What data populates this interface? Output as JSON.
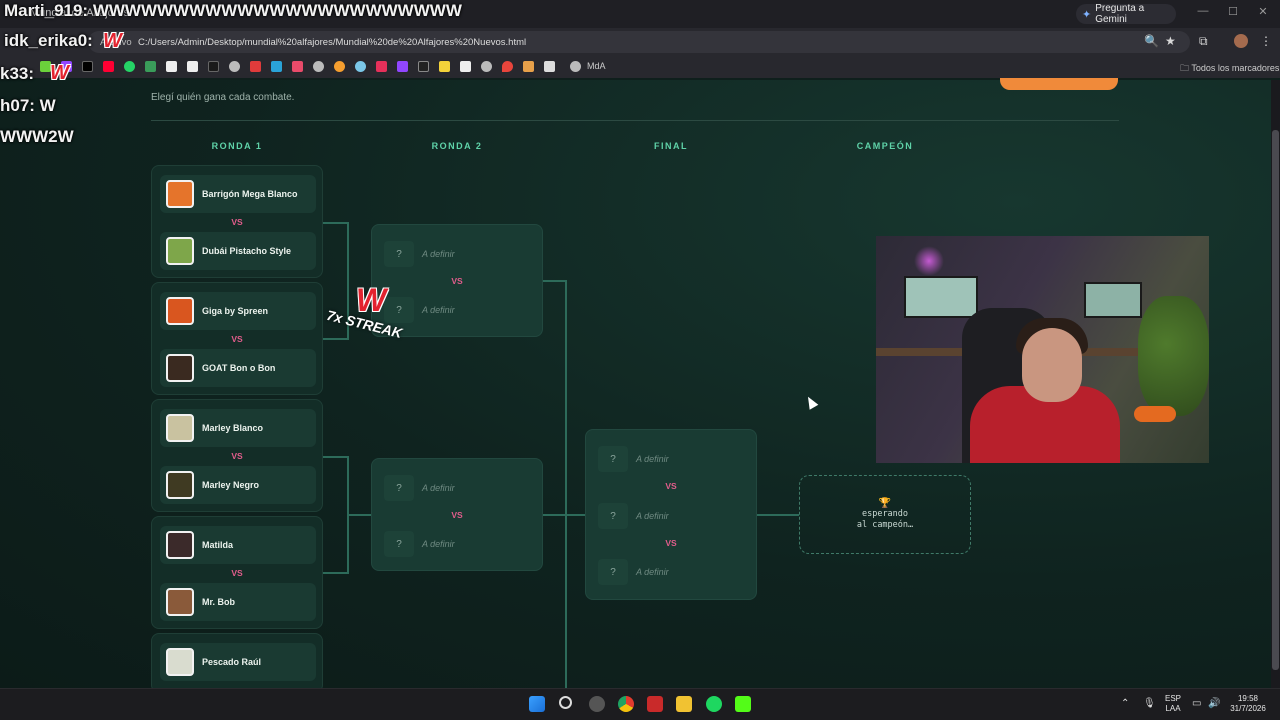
{
  "browser": {
    "tab_title": "Mundial de Alfajores",
    "gemini_label": "Pregunta a Gemini",
    "archivo_label": "Archivo",
    "url": "C:/Users/Admin/Desktop/mundial%20alfajores/Mundial%20de%20Alfajores%20Nuevos.html",
    "bookmark_last": "MdA",
    "all_bookmarks": "Todos los marcadores"
  },
  "page": {
    "subtitle": "Elegí quién gana cada combate.",
    "rounds": [
      "RONDA 1",
      "RONDA 2",
      "FINAL",
      "CAMPEÓN"
    ],
    "vs_label": "VS",
    "tbd_label": "A definir",
    "q_mark": "?",
    "round1": [
      {
        "a": "Barrigón Mega Blanco",
        "b": "Dubái Pistacho Style"
      },
      {
        "a": "Giga by Spreen",
        "b": "GOAT Bon o Bon"
      },
      {
        "a": "Marley Blanco",
        "b": "Marley Negro"
      },
      {
        "a": "Matilda",
        "b": "Mr. Bob"
      },
      {
        "a": "Pescado Raúl",
        "b": ""
      }
    ],
    "champion_icon": "trophy-icon",
    "champion_trophy": "🏆",
    "champion_text": "esperando\nal campeón…"
  },
  "overlay": {
    "chat_lines": [
      "Marti_919: WWWWWWWWWWWWWWWWWWWWWWW",
      "idk_erika0:",
      "k33:",
      "h07: W",
      "WWW2W"
    ],
    "streak": "7x STREAK",
    "w_logo": "W"
  },
  "taskbar": {
    "lang_top": "ESP",
    "lang_bottom": "LAA",
    "time": "19:58",
    "date": "31/7/2026"
  },
  "colors": {
    "accent_green": "#5fd3a9",
    "vs_pink": "#e25d8c",
    "orange_button": "#f08a3a",
    "w_red": "#e3232f"
  }
}
